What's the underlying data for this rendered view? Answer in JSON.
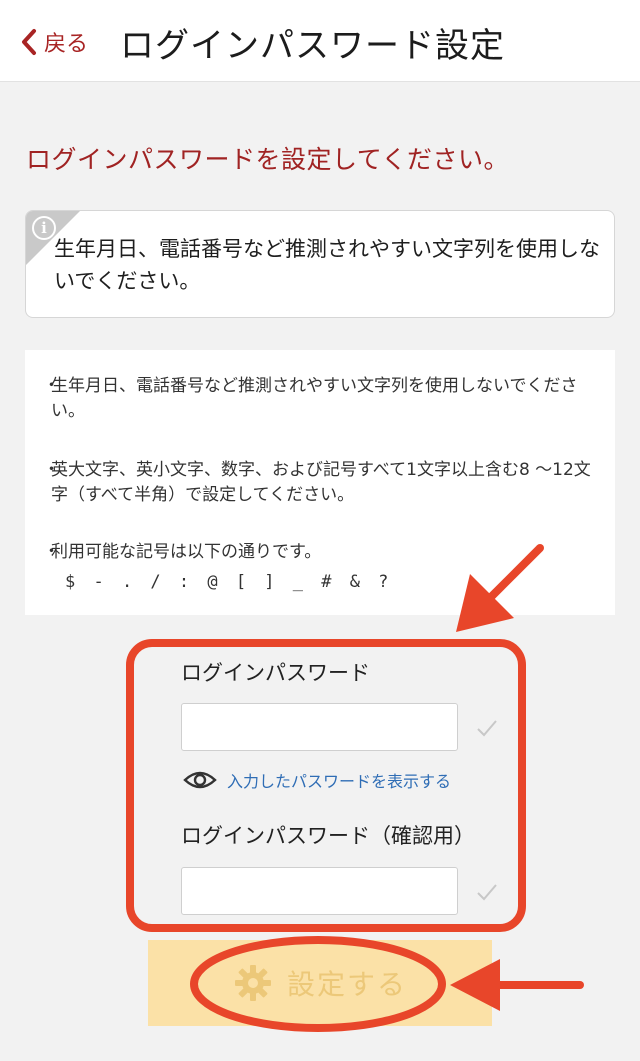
{
  "header": {
    "back_label": "戻る",
    "title": "ログインパスワード設定"
  },
  "lead": "ログインパスワードを設定してください。",
  "notice": {
    "icon": "info-icon",
    "text": "生年月日、電話番号など推測されやすい文字列を使用しないでください。"
  },
  "rules": [
    "生年月日、電話番号など推測されやすい文字列を使用しないでください。",
    "英大文字、英小文字、数字、および記号すべて1文字以上含む8 ～12文字（すべて半角）で設定してください。",
    "利用可能な記号は以下の通りです。"
  ],
  "symbols": "$ - . / : @ [ ] _ # & ?",
  "form": {
    "password_label": "ログインパスワード",
    "password_value": "",
    "show_password_label": "入力したパスワードを表示する",
    "confirm_label": "ログインパスワード（確認用）",
    "confirm_value": ""
  },
  "submit_label": "設定する",
  "colors": {
    "accent": "#a02323",
    "link": "#2f6db5",
    "submit_bg": "#fbe1a7",
    "annotation": "#e8462a"
  }
}
